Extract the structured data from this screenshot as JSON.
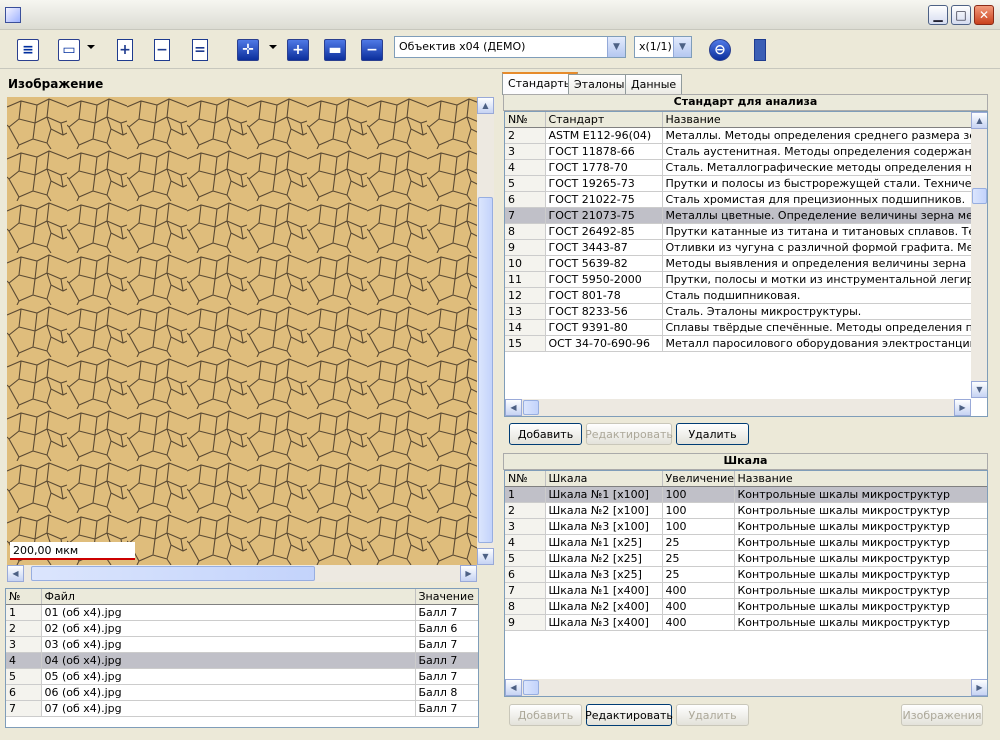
{
  "window": {
    "title": "",
    "icons": [
      "app-icon",
      "minimize-icon",
      "maximize-icon",
      "close-icon"
    ]
  },
  "toolbar": {
    "objective": "Объектив х04 (ДЕМО)",
    "zoom": "x(1/1)"
  },
  "left": {
    "title": "Изображение",
    "scale_label": "200,00 мкм",
    "files_headers": [
      "№",
      "Файл",
      "Значение"
    ],
    "files": [
      [
        "1",
        "01 (об х4).jpg",
        "Балл 7"
      ],
      [
        "2",
        "02 (об х4).jpg",
        "Балл 6"
      ],
      [
        "3",
        "03 (об х4).jpg",
        "Балл 7"
      ],
      [
        "4",
        "04 (об х4).jpg",
        "Балл 7"
      ],
      [
        "5",
        "05 (об х4).jpg",
        "Балл 7"
      ],
      [
        "6",
        "06 (об х4).jpg",
        "Балл 8"
      ],
      [
        "7",
        "07 (об х4).jpg",
        "Балл 7"
      ]
    ],
    "selected_file": 3
  },
  "right": {
    "tabs": [
      "Стандарты",
      "Эталоны",
      "Данные"
    ],
    "active_tab": 0,
    "standards": {
      "title": "Стандарт для анализа",
      "headers": [
        "N№",
        "Стандарт",
        "Название"
      ],
      "rows": [
        [
          "2",
          "ASTM E112-96(04)",
          "Металлы. Методы определения среднего размера зерна."
        ],
        [
          "3",
          "ГОСТ 11878-66",
          "Сталь аустенитная. Методы определения содержания ферр"
        ],
        [
          "4",
          "ГОСТ 1778-70",
          "Сталь. Металлографические методы определения неметал."
        ],
        [
          "5",
          "ГОСТ 19265-73",
          "Прутки и полосы из быстрорежущей стали. Технические ус"
        ],
        [
          "6",
          "ГОСТ 21022-75",
          "Сталь хромистая для прецизионных подшипников."
        ],
        [
          "7",
          "ГОСТ 21073-75",
          "Металлы цветные. Определение величины зерна методом с"
        ],
        [
          "8",
          "ГОСТ 26492-85",
          "Прутки катанные из титана и титановых сплавов. Техничес"
        ],
        [
          "9",
          "ГОСТ 3443-87",
          "Отливки из чугуна с различной формой графита. Методы оп"
        ],
        [
          "10",
          "ГОСТ 5639-82",
          "Методы выявления и определения величины зерна"
        ],
        [
          "11",
          "ГОСТ 5950-2000",
          "Прутки, полосы и мотки из инструментальной легированно"
        ],
        [
          "12",
          "ГОСТ 801-78",
          "Сталь подшипниковая."
        ],
        [
          "13",
          "ГОСТ 8233-56",
          "Сталь. Эталоны микроструктуры."
        ],
        [
          "14",
          "ГОСТ 9391-80",
          "Сплавы твёрдые спечённые. Методы определения пористос"
        ],
        [
          "15",
          "ОСТ 34-70-690-96",
          "Металл паросилового оборудования электростанций. Метод"
        ]
      ],
      "selected": 5,
      "buttons": {
        "add": "Добавить",
        "edit": "Редактировать",
        "delete": "Удалить"
      }
    },
    "scales": {
      "title": "Шкала",
      "headers": [
        "N№",
        "Шкала",
        "Увеличение",
        "Название"
      ],
      "rows": [
        [
          "1",
          "Шкала №1 [x100]",
          "100",
          "Контрольные шкалы микроструктур"
        ],
        [
          "2",
          "Шкала №2 [x100]",
          "100",
          "Контрольные шкалы микроструктур"
        ],
        [
          "3",
          "Шкала №3 [x100]",
          "100",
          "Контрольные шкалы микроструктур"
        ],
        [
          "4",
          "Шкала №1 [x25]",
          "25",
          "Контрольные шкалы микроструктур"
        ],
        [
          "5",
          "Шкала №2 [x25]",
          "25",
          "Контрольные шкалы микроструктур"
        ],
        [
          "6",
          "Шкала №3 [x25]",
          "25",
          "Контрольные шкалы микроструктур"
        ],
        [
          "7",
          "Шкала №1 [x400]",
          "400",
          "Контрольные шкалы микроструктур"
        ],
        [
          "8",
          "Шкала №2 [x400]",
          "400",
          "Контрольные шкалы микроструктур"
        ],
        [
          "9",
          "Шкала №3 [x400]",
          "400",
          "Контрольные шкалы микроструктур"
        ]
      ],
      "selected": 0,
      "buttons": {
        "add": "Добавить",
        "edit": "Редактировать",
        "delete": "Удалить",
        "images": "Изображения"
      }
    }
  }
}
